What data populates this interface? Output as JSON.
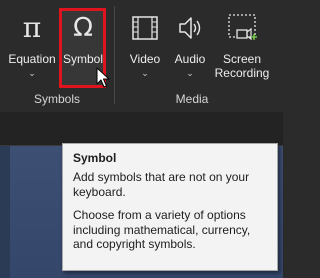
{
  "ribbon": {
    "groups": {
      "symbols_label": "Symbols",
      "media_label": "Media"
    },
    "buttons": {
      "equation": {
        "label": "Equation",
        "icon": "pi-icon"
      },
      "symbol": {
        "label": "Symbol",
        "icon": "omega-icon",
        "glyph": "Ω"
      },
      "video": {
        "label": "Video",
        "icon": "film-icon"
      },
      "audio": {
        "label": "Audio",
        "icon": "speaker-icon"
      },
      "screen_recording": {
        "label_line1": "Screen",
        "label_line2": "Recording",
        "icon": "screen-recording-icon"
      }
    },
    "equation_glyph": "π"
  },
  "tooltip": {
    "title": "Symbol",
    "para1": "Add symbols that are not on your keyboard.",
    "para2": "Choose from a variety of options including mathematical, currency, and copyright symbols."
  },
  "colors": {
    "highlight": "#e0141e",
    "ribbon_bg": "#2b2b2b",
    "tooltip_bg": "#f3f3f3",
    "slide_bg": "#3d4f73"
  }
}
